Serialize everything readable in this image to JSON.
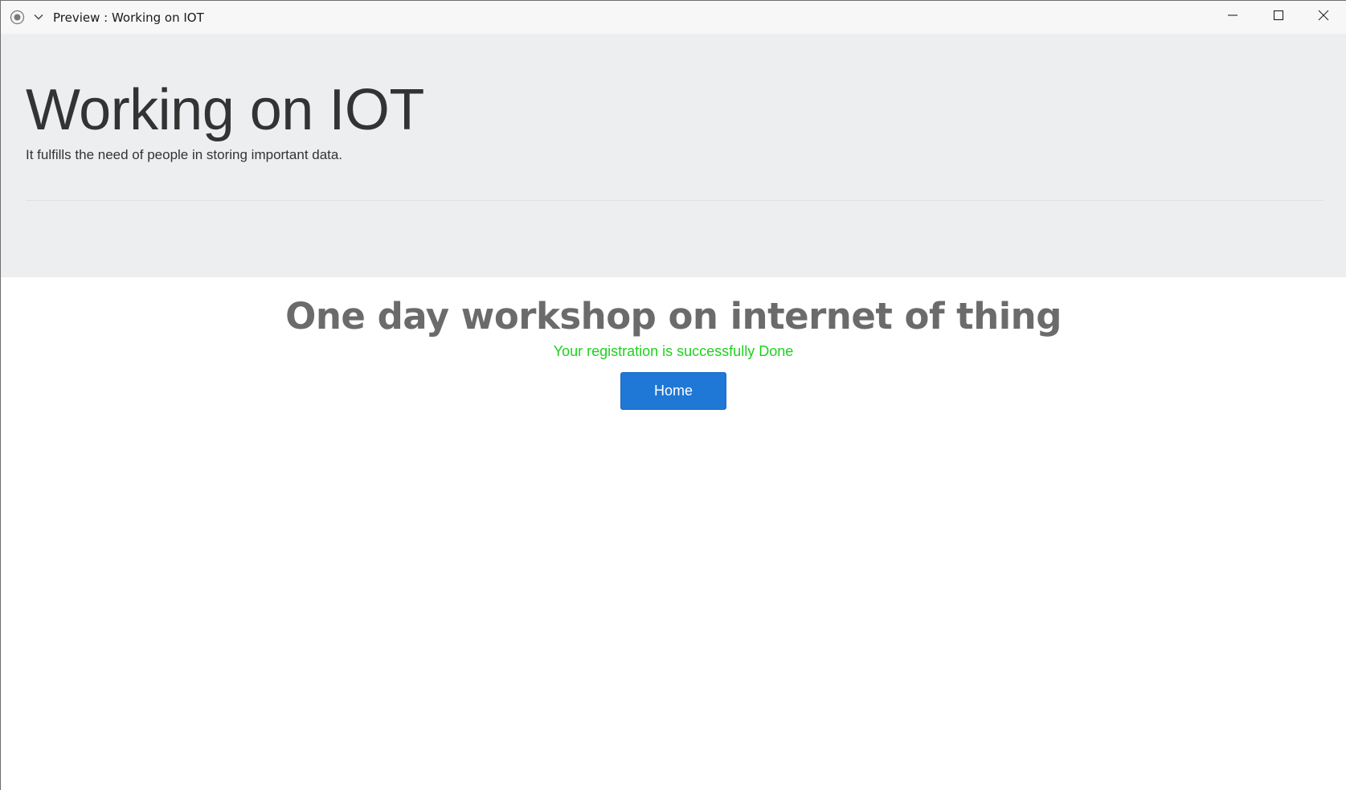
{
  "window": {
    "title": "Preview : Working on IOT",
    "icons": [
      "app-record-icon",
      "chevron-down-icon",
      "minimize-icon",
      "maximize-icon",
      "close-icon"
    ]
  },
  "jumbotron": {
    "title": "Working on IOT",
    "subtitle": "It fulfills the need of people in storing important data."
  },
  "main": {
    "heading": "One day workshop on internet of thing",
    "status_message": "Your registration is successfully Done",
    "home_button": "Home"
  },
  "colors": {
    "jumbotron_bg": "#eceef0",
    "success_text": "#1fd01f",
    "button_bg": "#1f77d6",
    "heading_text": "#6b6b6b"
  }
}
